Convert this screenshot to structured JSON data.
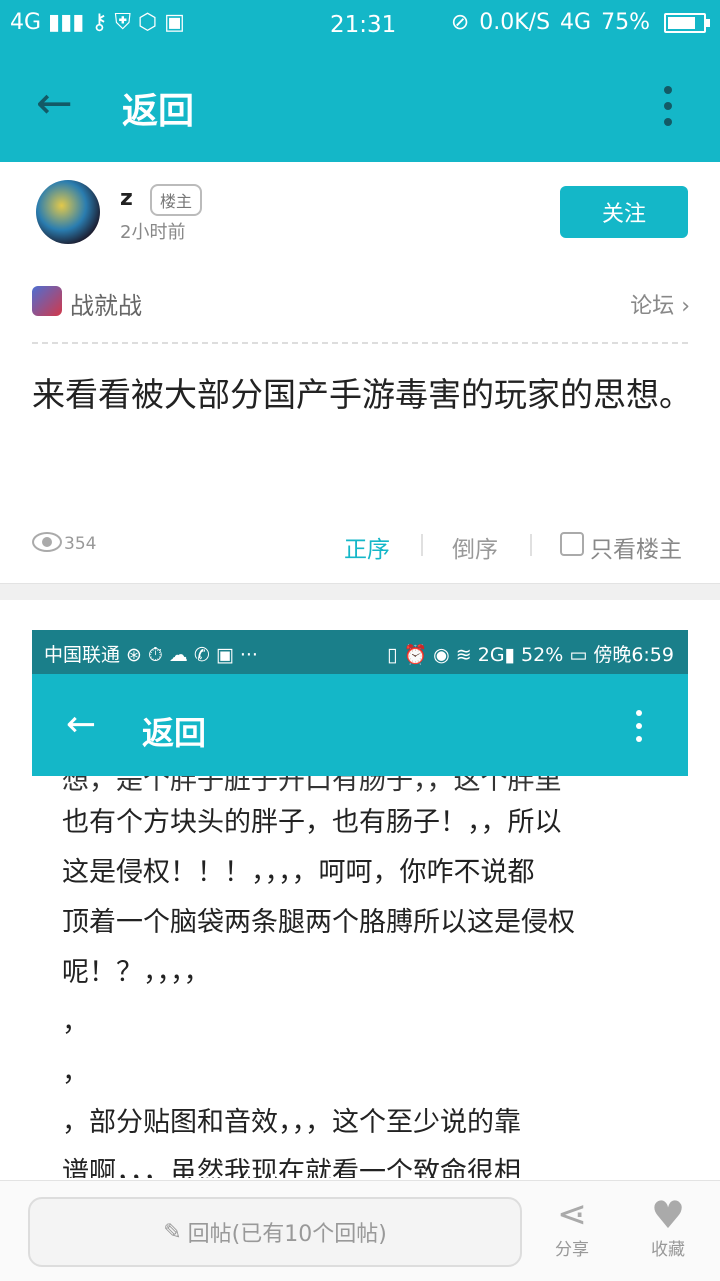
{
  "status_bar": {
    "left_icons": "4G ▮▮▮ ⚷ ⛨ ⬡ ▣",
    "time": "21:31",
    "speed": "0.0K/S",
    "net": "4G",
    "battery": "75%"
  },
  "header": {
    "back_label": "←",
    "title": "返回"
  },
  "post": {
    "author": "z",
    "author_badge": "楼主",
    "time": "2小时前",
    "follow_label": "关注",
    "forum_name": "战就战",
    "forum_link": "论坛 ›",
    "title": "来看看被大部分国产手游毒害的玩家的思想。",
    "views": "354",
    "order_asc": "正序",
    "order_desc": "倒序",
    "only_author": "只看楼主"
  },
  "embedded_screenshot": {
    "status_left": "中国联通 ⊛ ⏱ ☁ ✆ ▣ ···",
    "status_right": "▯ ⏰ ◉ ≋ 2G▮ 52% ▭ 傍晚6:59",
    "title": "返回",
    "lines": [
      "想，是个胖子脏子开口有肠子，，这个胖里",
      "也有个方块头的胖子，也有肠子！，，所以",
      "这是侵权！！！，，，，呵呵，你咋不说都",
      "顶着一个脑袋两条腿两个胳膊所以这是侵权",
      "呢！？，，，，",
      "，",
      "，",
      "，部分贴图和音效，，，这个至少说的靠",
      "谱啊，，，虽然我现在就看一个致命很相"
    ]
  },
  "bottom_bar": {
    "reply_placeholder": "回帖(已有10个回帖)",
    "share_label": "分享",
    "fav_label": "收藏"
  },
  "colors": {
    "accent": "#14b7c8",
    "dark_accent": "#135a66"
  }
}
